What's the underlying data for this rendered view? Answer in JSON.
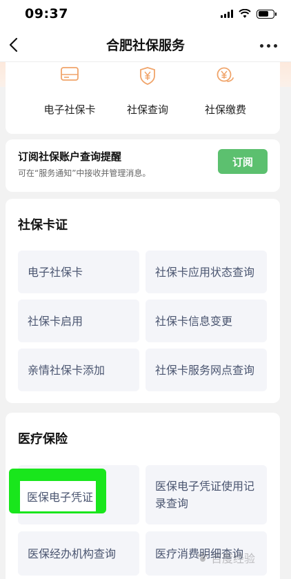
{
  "status_bar": {
    "time": "09:37"
  },
  "nav": {
    "title": "合肥社保服务"
  },
  "quick_actions": [
    {
      "label": "电子社保卡",
      "icon": "card-icon"
    },
    {
      "label": "社保查询",
      "icon": "shield-yuan-icon"
    },
    {
      "label": "社保缴费",
      "icon": "yuan-pay-icon"
    }
  ],
  "subscribe": {
    "title": "订阅社保账户查询提醒",
    "desc": "可在“服务通知”中接收并管理消息。",
    "button": "订阅"
  },
  "card_services": {
    "title": "社保卡证",
    "items": [
      "电子社保卡",
      "社保卡应用状态查询",
      "社保卡启用",
      "社保卡信息变更",
      "亲情社保卡添加",
      "社保卡服务网点查询"
    ]
  },
  "medical": {
    "title": "医疗保险",
    "items": [
      "医保电子凭证",
      "医保电子凭证使用记录查询",
      "医保经办机构查询",
      "医疗消费明细查询"
    ],
    "item2_line1": "医保电子凭证使用记",
    "item2_line2": "录查询"
  },
  "watermark": "百度经验",
  "colors": {
    "accent": "#5cc06f",
    "highlight": "#19e61c",
    "item_text": "#4a5570"
  }
}
